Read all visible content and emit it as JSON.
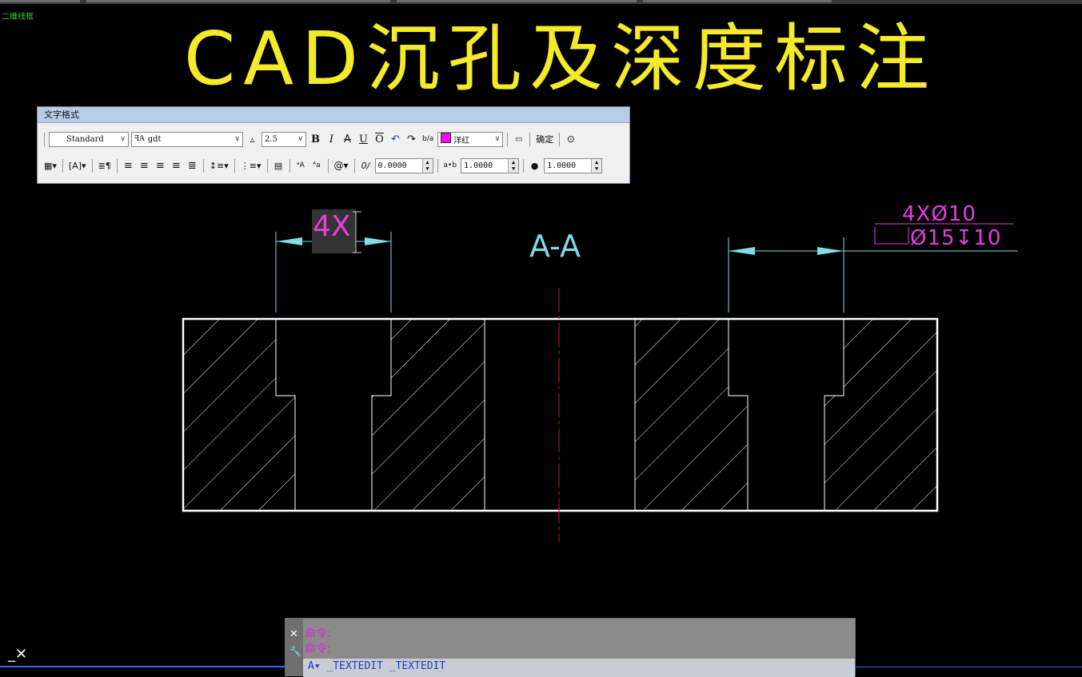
{
  "viewport_label": "二维线框",
  "title": "CAD沉孔及深度标注",
  "section_label": "A-A",
  "editing_text": "4X",
  "dim_text_line1": "4XØ10",
  "dim_text_line2": "Ø15↧10",
  "toolbar": {
    "title": "文字格式",
    "style": "Standard",
    "font": "gdt",
    "height": "2.5",
    "bold": "B",
    "italic": "I",
    "strike": "A",
    "underline": "U",
    "overline": "O",
    "undo": "↶",
    "redo": "↷",
    "stack": "b/a",
    "color": "洋红",
    "ok": "确定",
    "oblique": "0.0000",
    "tracking": "1.0000",
    "width_factor": "1.0000"
  },
  "command": {
    "line1": "命令:",
    "line2": "命令:",
    "input": "A▾ _TEXTEDIT _TEXTEDIT"
  },
  "colors": {
    "title": "#f4ea2a",
    "outline": "#ffffff",
    "dimension": "#7fdde3",
    "annotation": "#e040e0",
    "centerline": "#d0161b"
  }
}
